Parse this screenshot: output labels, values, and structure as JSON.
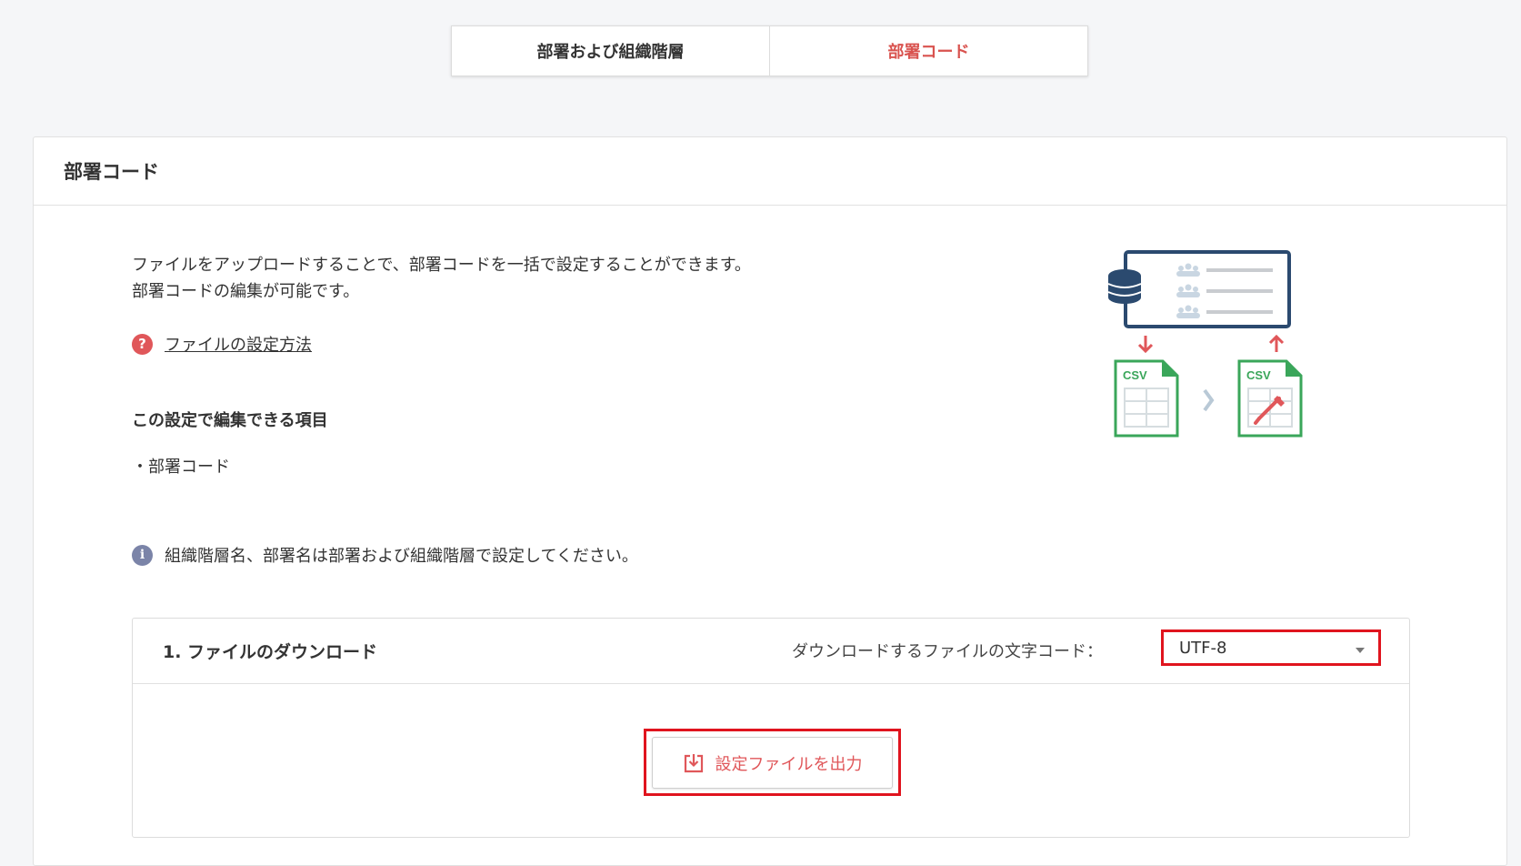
{
  "tabs": [
    {
      "label": "部署および組織階層",
      "active": false
    },
    {
      "label": "部署コード",
      "active": true
    }
  ],
  "card": {
    "title": "部署コード",
    "description_line1": "ファイルをアップロードすることで、部署コードを一括で設定することができます。",
    "description_line2": "部署コードの編集が可能です。",
    "help_link": "ファイルの設定方法",
    "editable_items_title": "この設定で編集できる項目",
    "editable_items": [
      "・部署コード"
    ],
    "info_text": "組織階層名、部署名は部署および組織階層で設定してください。",
    "illustration": {
      "csv_label_left": "CSV",
      "csv_label_right": "CSV"
    }
  },
  "download": {
    "title": "1. ファイルのダウンロード",
    "encoding_label": "ダウンロードするファイルの文字コード：",
    "encoding_value": "UTF-8",
    "export_button": "設定ファイルを出力"
  },
  "colors": {
    "accent": "#d9534f",
    "highlight_border": "#e0141e",
    "navy": "#2b4a6f",
    "csv_green": "#3aa65a"
  }
}
